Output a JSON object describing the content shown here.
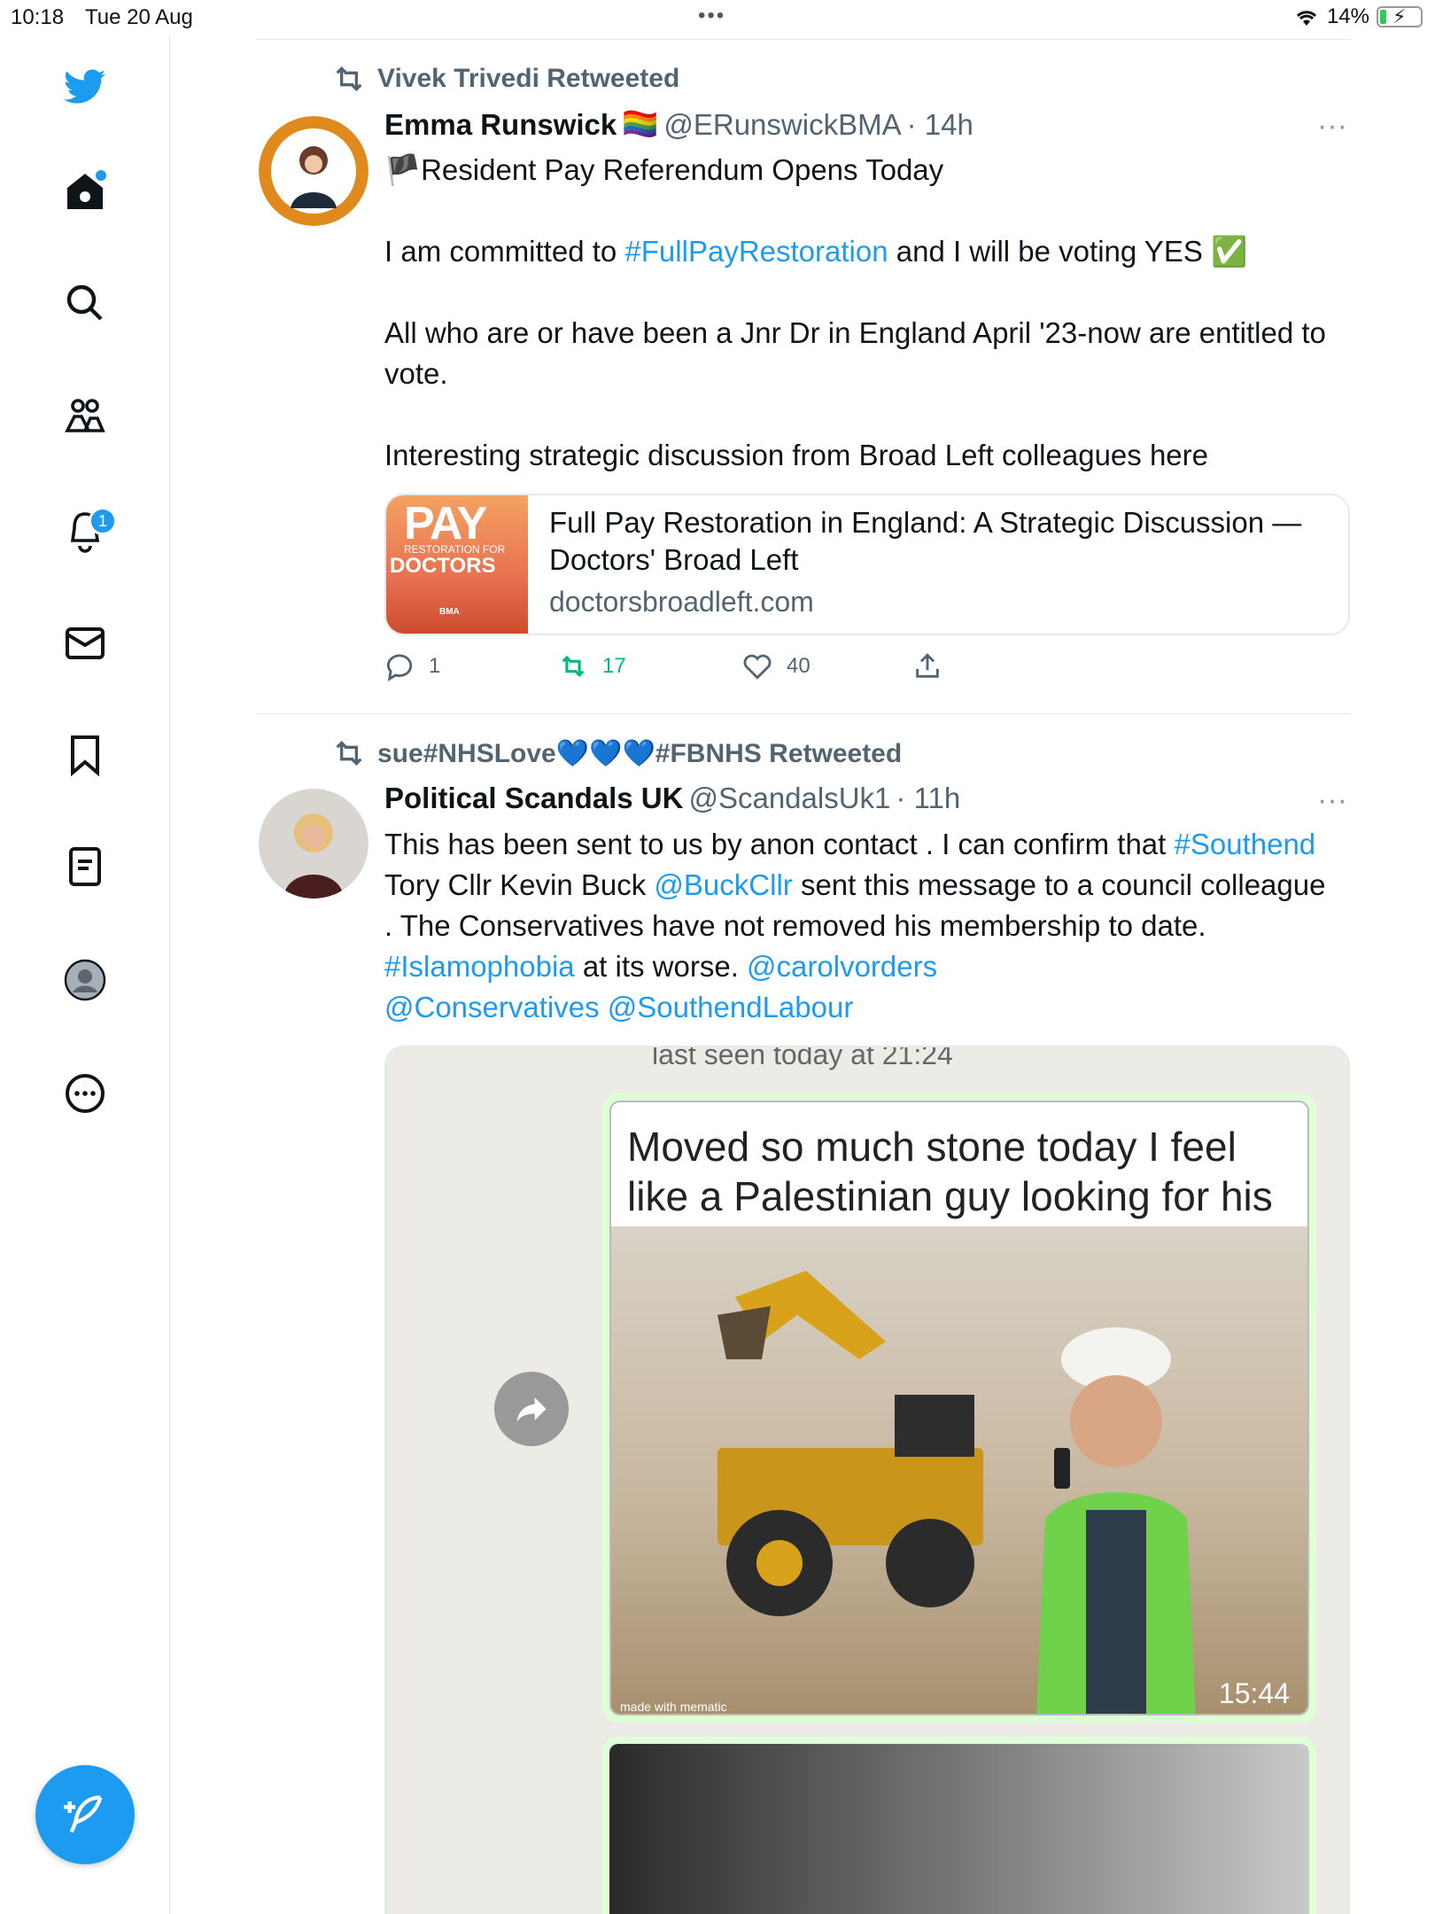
{
  "status_bar": {
    "time": "10:18",
    "date": "Tue 20 Aug",
    "battery": "14%",
    "battery_level": 0.14
  },
  "sidebar": {
    "notification_count": "1",
    "items": [
      {
        "name": "twitter-logo-icon"
      },
      {
        "name": "home-icon"
      },
      {
        "name": "search-icon"
      },
      {
        "name": "communities-icon"
      },
      {
        "name": "notifications-icon"
      },
      {
        "name": "messages-icon"
      },
      {
        "name": "bookmarks-icon"
      },
      {
        "name": "lists-icon"
      },
      {
        "name": "profile-icon"
      },
      {
        "name": "more-icon"
      }
    ],
    "compose_icon": "compose-tweet-icon"
  },
  "tweets": [
    {
      "retweeted_by": "Vivek Trivedi Retweeted",
      "name": "Emma Runswick",
      "name_emoji": "🏳️‍🌈",
      "handle": "@ERunswickBMA",
      "time": "· 14h",
      "text": {
        "line1_flag": "🏴",
        "line1": "Resident Pay Referendum Opens Today",
        "p2_a": "I am committed to ",
        "p2_hashtag": "#FullPayRestoration",
        "p2_b": " and I will be voting YES ✅",
        "p3": "All who are or have been a Jnr Dr in England April '23-now are entitled to vote.",
        "p4": "Interesting strategic discussion from Broad Left colleagues here"
      },
      "card": {
        "image_text_1": "PAY",
        "image_text_2": "RESTORATION FOR",
        "image_text_3": "DOCTORS",
        "image_text_4": "BMA",
        "title": "Full Pay Restoration in England: A Strategic Discussion — Doctors' Broad Left",
        "domain": "doctorsbroadleft.com"
      },
      "actions": {
        "replies": "1",
        "retweets": "17",
        "likes": "40"
      }
    },
    {
      "retweeted_by": "sue#NHSLove💙💙💙#FBNHS Retweeted",
      "name": "Political Scandals UK",
      "handle": "@ScandalsUk1",
      "time": "· 11h",
      "text": {
        "s1": "This has been sent to us by anon contact . I can confirm that ",
        "h1": "#Southend",
        "s2": " Tory Cllr Kevin Buck ",
        "h2": "@BuckCllr",
        "s3": " sent this message to a council colleague . The Conservatives have not removed his membership to date. ",
        "h3": "#Islamophobia",
        "s4": " at its worse. ",
        "h4": "@carolvorders",
        "h5": "@Conservatives",
        "h6": "@SouthendLabour"
      },
      "media": {
        "top_text": "last seen today at 21:24",
        "caption": "Moved so much stone today I feel like a Palestinian guy looking for his wife",
        "timestamp": "15:44",
        "watermark": "made with mematic"
      }
    }
  ],
  "colors": {
    "accent": "#1d9bf0",
    "retweet_green": "#00ba7c",
    "secondary_text": "#536471"
  }
}
